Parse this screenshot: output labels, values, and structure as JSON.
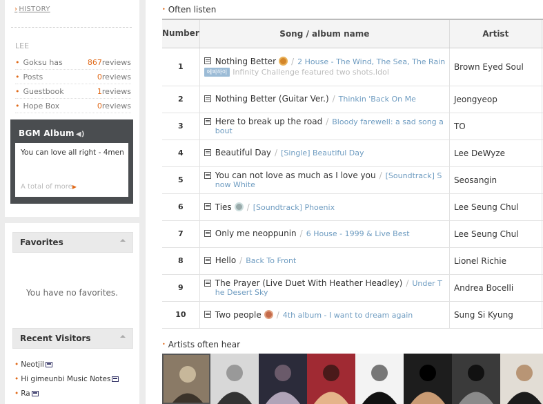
{
  "left": {
    "history_link": "HISTORY",
    "user": "LEE",
    "stats": [
      {
        "label": "Goksu has",
        "count": "867",
        "unit": "reviews"
      },
      {
        "label": "Posts",
        "count": "0",
        "unit": "reviews"
      },
      {
        "label": "Guestbook",
        "count": "1",
        "unit": "reviews"
      },
      {
        "label": "Hope Box",
        "count": "0",
        "unit": "reviews"
      }
    ],
    "bgm": {
      "title": "BGM Album",
      "song": "You can love all right - 4men",
      "more": "A total of more"
    },
    "favorites": {
      "title": "Favorites",
      "empty": "You have no favorites."
    },
    "visitors": {
      "title": "Recent Visitors",
      "items": [
        "Neotjil",
        "Hi gimeunbi Music Notes",
        "Ra"
      ]
    }
  },
  "main": {
    "often_listen": "Often listen",
    "headers": {
      "num": "Number",
      "song": "Song / album name",
      "artist": "Artist"
    },
    "rows": [
      {
        "num": "1",
        "song": "Nothing Better",
        "album": "2 House - The Wind, The Sea, The Rain",
        "artist": "Brown Eyed Soul",
        "medal": "gold",
        "tag": "에픽하이",
        "note": "Infinity Challenge featured two shots.Idol"
      },
      {
        "num": "2",
        "song": "Nothing Better (Guitar Ver.)",
        "album": "Thinkin 'Back On Me",
        "artist": "Jeongyeop"
      },
      {
        "num": "3",
        "song": "Here to break up the road",
        "album": "Bloody farewell: a sad song about",
        "artist": "TO"
      },
      {
        "num": "4",
        "song": "Beautiful Day",
        "album": "[Single] Beautiful Day",
        "artist": "Lee DeWyze"
      },
      {
        "num": "5",
        "song": "You can not love as much as I love you",
        "album": "[Soundtrack] Snow White",
        "artist": "Seosangin"
      },
      {
        "num": "6",
        "song": "Ties",
        "album": "[Soundtrack] Phoenix",
        "artist": "Lee Seung Chul",
        "medal": "silver"
      },
      {
        "num": "7",
        "song": "Only me neoppunin",
        "album": "6 House - 1999 & Live Best",
        "artist": "Lee Seung Chul"
      },
      {
        "num": "8",
        "song": "Hello",
        "album": "Back To Front",
        "artist": "Lionel Richie"
      },
      {
        "num": "9",
        "song": "The Prayer (Live Duet With Heather Headley)",
        "album": "Under The Desert Sky",
        "artist": "Andrea Bocelli"
      },
      {
        "num": "10",
        "song": "Two people",
        "album": "4th album - I want to dream again",
        "artist": "Sung Si Kyung",
        "medal": "bronze"
      }
    ],
    "artists_often": "Artists often hear",
    "artist_photos": [
      "artist-photo-1",
      "artist-photo-2",
      "artist-photo-3",
      "artist-photo-4",
      "artist-photo-5",
      "artist-photo-6",
      "artist-photo-7",
      "artist-photo-8"
    ]
  }
}
